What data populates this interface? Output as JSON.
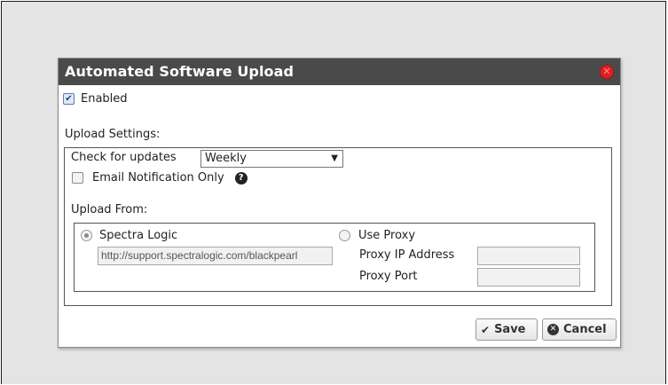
{
  "dialog": {
    "title": "Automated Software Upload"
  },
  "enabled": {
    "label": "Enabled",
    "checked": true
  },
  "upload_settings": {
    "heading": "Upload Settings:",
    "check_for_updates_label": "Check for updates",
    "frequency_selected": "Weekly",
    "email_notification": {
      "label": "Email Notification Only",
      "checked": false
    }
  },
  "upload_from": {
    "heading": "Upload From:",
    "spectra_logic": {
      "label": "Spectra Logic",
      "selected": true,
      "url": "http://support.spectralogic.com/blackpearl"
    },
    "use_proxy": {
      "label": "Use Proxy",
      "selected": false
    },
    "proxy_ip_label": "Proxy IP Address",
    "proxy_ip_value": "",
    "proxy_port_label": "Proxy Port",
    "proxy_port_value": ""
  },
  "buttons": {
    "save": "Save",
    "cancel": "Cancel"
  },
  "icons": {
    "close": "close-icon",
    "help": "help-icon",
    "save": "checkmark-icon",
    "cancel": "cancel-circle-icon"
  },
  "colors": {
    "titlebar": "#4a4a4a",
    "close": "#e02020",
    "background": "#e4e4e4"
  }
}
